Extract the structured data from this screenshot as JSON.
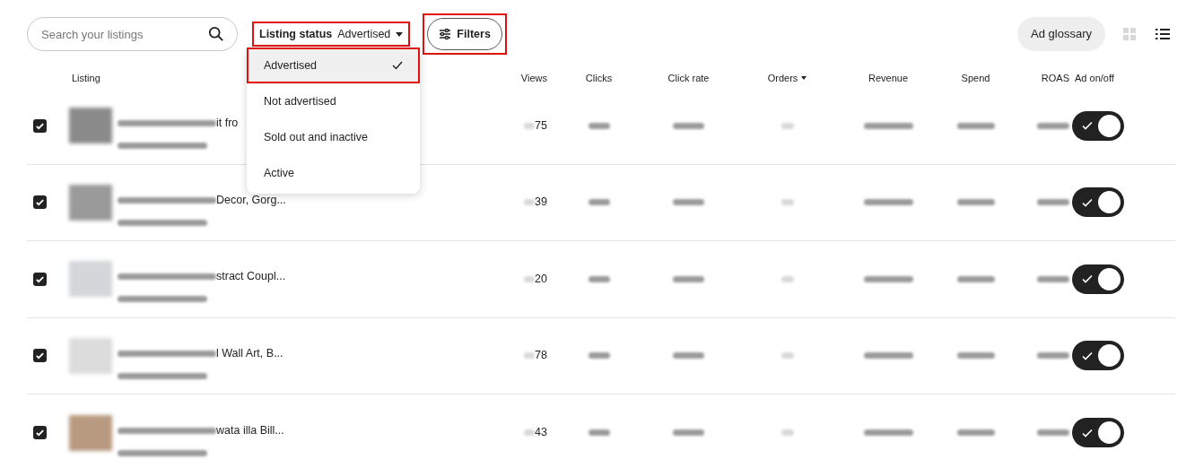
{
  "toolbar": {
    "search": {
      "placeholder": "Search your listings"
    },
    "status_filter": {
      "label": "Listing status",
      "value": "Advertised",
      "highlighted": true,
      "expanded": true
    },
    "filters_button": {
      "label": "Filters",
      "highlighted": true
    },
    "ad_glossary": "Ad glossary",
    "view_mode": [
      {
        "kind": "grid",
        "selected": false
      },
      {
        "kind": "list",
        "selected": true
      }
    ]
  },
  "status_menu": [
    {
      "label": "Advertised",
      "selected": true,
      "highlighted": true
    },
    {
      "label": "Not advertised",
      "selected": false,
      "highlighted": false
    },
    {
      "label": "Sold out and inactive",
      "selected": false,
      "highlighted": false
    },
    {
      "label": "Active",
      "selected": false,
      "highlighted": false
    }
  ],
  "table": {
    "columns": [
      {
        "label": "Listing",
        "sorted": false
      },
      {
        "label": "Views",
        "sorted": false
      },
      {
        "label": "Clicks",
        "sorted": false
      },
      {
        "label": "Click rate",
        "sorted": false
      },
      {
        "label": "Orders",
        "sorted": true
      },
      {
        "label": "Revenue",
        "sorted": false
      },
      {
        "label": "Spend",
        "sorted": false
      },
      {
        "label": "ROAS",
        "sorted": false
      },
      {
        "label": "Ad on/off",
        "sorted": false
      }
    ],
    "rows": [
      {
        "checked": true,
        "title": "it fro",
        "views": "75",
        "ad_on": true
      },
      {
        "checked": true,
        "title": "Decor, Gorg...",
        "views": "39",
        "ad_on": true
      },
      {
        "checked": true,
        "title": "stract Coupl...",
        "views": "20",
        "ad_on": true
      },
      {
        "checked": true,
        "title": "l Wall Art, B...",
        "views": "78",
        "ad_on": true
      },
      {
        "checked": true,
        "title": "wata illa Bill...",
        "views": "43",
        "ad_on": true
      }
    ]
  }
}
